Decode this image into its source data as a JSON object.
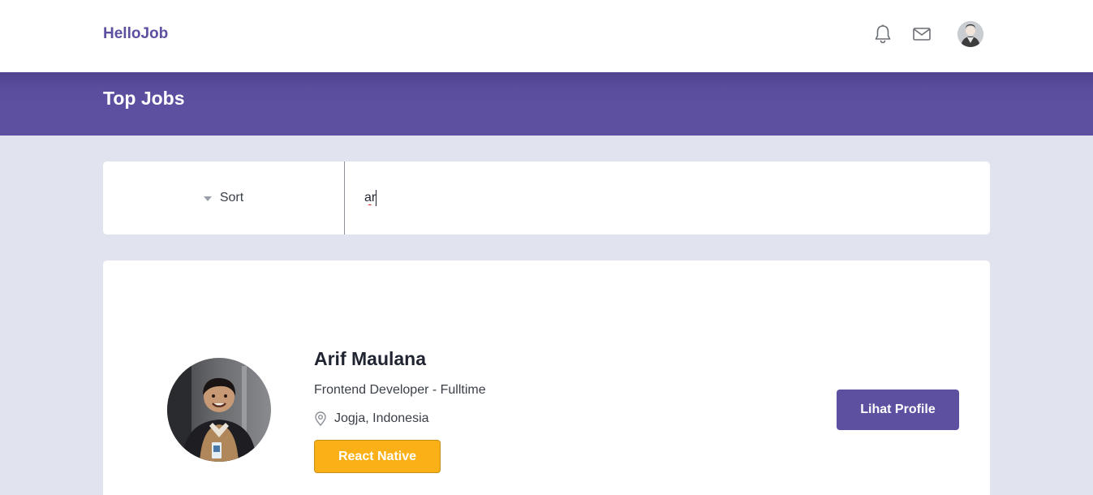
{
  "navbar": {
    "brand": "HelloJob",
    "icons": [
      "bell-icon",
      "mail-icon",
      "user-avatar"
    ]
  },
  "banner": {
    "title": "Top Jobs"
  },
  "filter": {
    "sort_label": "Sort",
    "search_value": "ar"
  },
  "candidate": {
    "name": "Arif Maulana",
    "role": "Frontend Developer - Fulltime",
    "location": "Jogja, Indonesia",
    "skills": [
      "React Native"
    ],
    "profile_button": "Lihat Profile"
  },
  "colors": {
    "brand": "#5e50a1",
    "page_bg": "#e1e4ee",
    "skill_badge": "#fbb017"
  }
}
